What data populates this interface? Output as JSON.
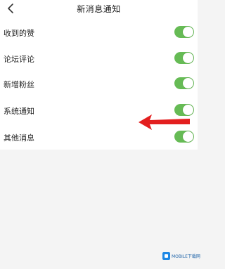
{
  "header": {
    "back_icon": "chevron-left-icon",
    "title": "新消息通知"
  },
  "settings": [
    {
      "label": "收到的赞",
      "enabled": true
    },
    {
      "label": "论坛评论",
      "enabled": true
    },
    {
      "label": "新增粉丝",
      "enabled": true
    },
    {
      "label": "系统通知",
      "enabled": true
    },
    {
      "label": "其他消息",
      "enabled": true
    }
  ],
  "colors": {
    "toggle_on": "#66bb55",
    "annotation_arrow": "#e31f1f"
  },
  "watermark": {
    "text": "MOBILE下载网"
  }
}
